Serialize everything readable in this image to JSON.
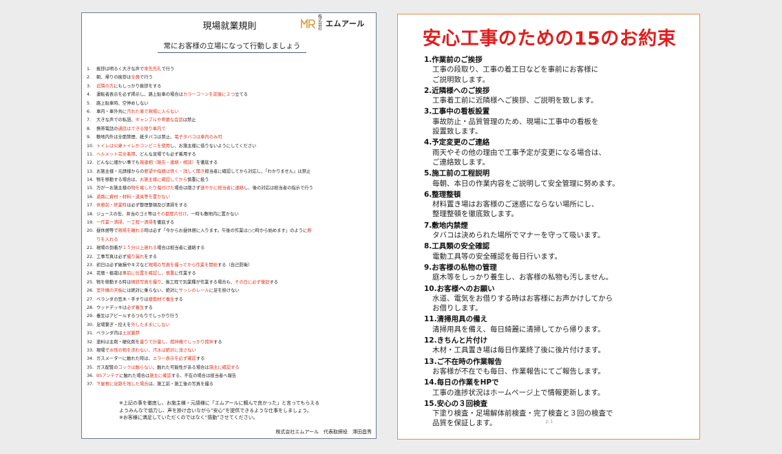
{
  "left": {
    "title": "現場就業規則",
    "logo": {
      "small": "株式会社",
      "name": "エムアール"
    },
    "subtitle": "常にお客様の立場になって行動しましょう",
    "rules": [
      {
        "n": "1.",
        "parts": [
          {
            "t": "挨拶は明るく大きな声で"
          },
          {
            "t": "率先先礼",
            "r": true
          },
          {
            "t": "で行う"
          }
        ]
      },
      {
        "n": "2.",
        "parts": [
          {
            "t": "朝、帰りの挨拶は"
          },
          {
            "t": "全員",
            "r": true
          },
          {
            "t": "で行う"
          }
        ]
      },
      {
        "n": "3.",
        "parts": [
          {
            "t": "近隣の方",
            "r": true
          },
          {
            "t": "にもしっかり挨拶をする"
          }
        ]
      },
      {
        "n": "4.",
        "parts": [
          {
            "t": "運転者表示を必ず掲示し、路上駐車の場合は"
          },
          {
            "t": "カラーコーンを前後に２つ",
            "r": true
          },
          {
            "t": "立てる"
          }
        ]
      },
      {
        "n": "5.",
        "parts": [
          {
            "t": "路上駐車時、空停めしない"
          }
        ]
      },
      {
        "n": "6.",
        "parts": [
          {
            "t": "車内・車外共に"
          },
          {
            "t": "汚れた車で現場に入らない",
            "r": true
          }
        ]
      },
      {
        "n": "7.",
        "parts": [
          {
            "t": "大きな声での私語、"
          },
          {
            "t": "ギャンブルや卑猥な会話",
            "r": true
          },
          {
            "t": "は禁止"
          }
        ]
      },
      {
        "n": "8.",
        "parts": [
          {
            "t": "携帯電話の"
          },
          {
            "t": "通話はできる限り車内で",
            "r": true
          }
        ]
      },
      {
        "n": "9.",
        "parts": [
          {
            "t": "敷地内外は"
          },
          {
            "t": "全面禁煙",
            "r": false
          },
          {
            "t": "、紙タバコは禁止、"
          },
          {
            "t": "電子タバコは車内のみ可",
            "r": true
          }
        ]
      },
      {
        "n": "10.",
        "parts": [
          {
            "t": "トイレは公衆トイレかコンビニを使用",
            "r": true
          },
          {
            "t": "し、お施主様に借りないようにしてください"
          }
        ]
      },
      {
        "n": "11.",
        "parts": [
          {
            "t": "ヘルメット完全着用",
            "r": true
          },
          {
            "t": "、どんな足場でも必ず着用する"
          }
        ]
      },
      {
        "n": "12.",
        "parts": [
          {
            "t": "どんなに細かい事でも"
          },
          {
            "t": "報連相（報告・連絡・相談）",
            "r": true
          },
          {
            "t": "を徹底する"
          }
        ]
      },
      {
        "n": "13.",
        "parts": [
          {
            "t": "お施主様・元請様からの"
          },
          {
            "t": "要望や指摘は快く・詳しく聞き",
            "r": true
          },
          {
            "t": "担当者に確認してから対応し、「わかりません」は禁止"
          }
        ]
      },
      {
        "n": "14.",
        "parts": [
          {
            "t": "物を移動する場合は、"
          },
          {
            "t": "お施主様に確認してから",
            "r": true
          },
          {
            "t": "慎重に扱う"
          }
        ]
      },
      {
        "n": "15.",
        "parts": [
          {
            "t": "万が一お施主様の"
          },
          {
            "t": "物を壊したり傷付けた",
            "r": true
          },
          {
            "t": "場合は隠さず"
          },
          {
            "t": "速やかに担当者に連絡",
            "r": true
          },
          {
            "t": "し、後の対応は担当者の指示で行う"
          }
        ]
      },
      {
        "n": "16.",
        "parts": [
          {
            "t": "道路に資材・材料・道具等を置かない",
            "r": true
          }
        ]
      },
      {
        "n": "17.",
        "parts": [
          {
            "t": "休憩前・終業時",
            "r": true
          },
          {
            "t": "は必ず整理整頓及び清掃をする"
          }
        ]
      },
      {
        "n": "18.",
        "parts": [
          {
            "t": "ジュースの缶、弁当のゴミ等は"
          },
          {
            "t": "その都度片付け",
            "r": true
          },
          {
            "t": "、一時も敷地内に置かない"
          }
        ]
      },
      {
        "n": "19.",
        "parts": [
          {
            "t": "一作業一清掃、一工程一清掃",
            "r": true
          },
          {
            "t": "を徹底する"
          }
        ]
      },
      {
        "n": "20.",
        "wrap": true,
        "parts": [
          {
            "t": "昼休憩等で"
          },
          {
            "t": "現場を離れる",
            "r": true
          },
          {
            "t": "時は必ず「今からお昼休憩に入ります。午後の作業は○○時から始めます」のように"
          },
          {
            "t": "断",
            "r": true
          }
        ],
        "cont": [
          {
            "t": "りを入れる",
            "r": true
          }
        ]
      },
      {
        "n": "21.",
        "parts": [
          {
            "t": "現場の到着が"
          },
          {
            "t": "１５分以上遅れる",
            "r": true
          },
          {
            "t": "場合は担当者に連絡する"
          }
        ]
      },
      {
        "n": "22.",
        "parts": [
          {
            "t": "工事写真は必ず"
          },
          {
            "t": "撮り漏れ",
            "r": true
          },
          {
            "t": "をする"
          }
        ]
      },
      {
        "n": "23.",
        "parts": [
          {
            "t": "初日は必ず破損やキズなど"
          },
          {
            "t": "現場の写真を撮ってから作業を開始",
            "r": true
          },
          {
            "t": "する（自己防衛）"
          }
        ]
      },
      {
        "n": "24.",
        "parts": [
          {
            "t": "花壇・植栽は"
          },
          {
            "t": "事前に位置を確認し、慎重",
            "r": true
          },
          {
            "t": "に作業する"
          }
        ]
      },
      {
        "n": "25.",
        "parts": [
          {
            "t": "物を移動する時は"
          },
          {
            "t": "現状写真を撮り",
            "r": true
          },
          {
            "t": "、後工程で別業種が作業する場合も、"
          },
          {
            "t": "その日に必ず復旧",
            "r": true
          },
          {
            "t": "する"
          }
        ]
      },
      {
        "n": "26.",
        "parts": [
          {
            "t": "室外機の天板",
            "r": true
          },
          {
            "t": "には絶対に乗らない、絶対に"
          },
          {
            "t": "サッシのレール",
            "r": true
          },
          {
            "t": "に足を掛けない"
          }
        ]
      },
      {
        "n": "27.",
        "parts": [
          {
            "t": "ベランダの笠木・手すりは"
          },
          {
            "t": "緩衝材で養生",
            "r": true
          },
          {
            "t": "する"
          }
        ]
      },
      {
        "n": "28.",
        "parts": [
          {
            "t": "ウッドデッキは"
          },
          {
            "t": "必ず養生",
            "r": true
          },
          {
            "t": "する"
          }
        ]
      },
      {
        "n": "29.",
        "parts": [
          {
            "t": "養生はアピールするつもりでしっかり行う"
          }
        ]
      },
      {
        "n": "30.",
        "parts": [
          {
            "t": "足場繋ぎ・控えを"
          },
          {
            "t": "外したままにしない",
            "r": true
          }
        ]
      },
      {
        "n": "31.",
        "parts": [
          {
            "t": "ベランダ内は"
          },
          {
            "t": "土足厳禁",
            "r": true
          }
        ]
      },
      {
        "n": "32.",
        "parts": [
          {
            "t": "塗料は主剤・硬化剤を"
          },
          {
            "t": "量りで計量し、撹拌機でしっかり撹拌",
            "r": true
          },
          {
            "t": "する"
          }
        ]
      },
      {
        "n": "33.",
        "parts": [
          {
            "t": "現場で"
          },
          {
            "t": "水性の物を洗わない、汚水は絶対に流さない",
            "r": true
          }
        ]
      },
      {
        "n": "34.",
        "parts": [
          {
            "t": "ガスメーターに触れた時は、"
          },
          {
            "t": "エラー表示を必ず確認",
            "r": true
          },
          {
            "t": "する"
          }
        ]
      },
      {
        "n": "35.",
        "parts": [
          {
            "t": "ガス配管の"
          },
          {
            "t": "コックは触らない",
            "r": true
          },
          {
            "t": "、触れた可能性がある場合は"
          },
          {
            "t": "施主に確認する",
            "r": true
          }
        ]
      },
      {
        "n": "36.",
        "parts": [
          {
            "t": "BSアンテナ",
            "r": true
          },
          {
            "t": "に触れた場合は"
          },
          {
            "t": "施主に確認",
            "r": true
          },
          {
            "t": "する、不在の場合は担当者へ報告"
          }
        ]
      },
      {
        "n": "37.",
        "parts": [
          {
            "t": "下屋根に足跡を残した場合",
            "r": true
          },
          {
            "t": "は、施工前・施工後の写真を撮る"
          }
        ]
      }
    ],
    "note_lines": [
      "※上記の事を徹底し、お施主様・元請様に「エムアールに頼んで良かった」と言ってもらえる",
      "ようみんなで協力し、声を掛け合いながら“安心”を提供できるような仕事をしましょう。",
      "※お客様に満足していただくのではなく“感動”させてください。"
    ],
    "signature": "株式会社エムアール　代表取締役　澤田昌秀"
  },
  "right": {
    "title": "安心工事のための15のお約束",
    "items": [
      {
        "head": "1.作業前のご挨拶",
        "body": [
          "工事の段取り、工事の着工日などを事前にお客様に",
          "ご説明致します。"
        ]
      },
      {
        "head": "2.近隣様へのご挨拶",
        "body": [
          "工事着工前に近隣様へご挨拶、ご説明を致します。"
        ]
      },
      {
        "head": "3.工事中の看板設置",
        "body": [
          "事故防止・品質管理のため、現場に工事中の看板を",
          "設置致します。"
        ]
      },
      {
        "head": "4.予定変更のご連絡",
        "body": [
          "雨天やその他の理由で工事予定が変更になる場合は、",
          "ご連絡致します。"
        ]
      },
      {
        "head": "5.施工前の工程説明",
        "body": [
          "毎朝、本日の作業内容をご説明して安全管理に努めます。"
        ]
      },
      {
        "head": "6.整理整頓",
        "body": [
          "材料置き場はお客様のご迷惑にならない場所にし、",
          "整理整頓を徹底致します。"
        ]
      },
      {
        "head": "7.敷地内禁煙",
        "body": [
          "タバコは決められた場所でマナーを守って吸います。"
        ]
      },
      {
        "head": "8.工具類の安全確認",
        "body": [
          "電動工具等の安全確認を毎日行います。"
        ]
      },
      {
        "head": "9.お客様の私物の管理",
        "body": [
          "庭木等をしっかり養生し、お客様の私物も汚しません。"
        ]
      },
      {
        "head": "10.お客様へのお願い",
        "body": [
          "水道、電気をお借りする時はお客様にお声かけしてから",
          "お借りします。"
        ]
      },
      {
        "head": "11.清掃用具の備え",
        "body": [
          "清掃用具を備え、毎日綺麗に清掃してから帰ります。"
        ]
      },
      {
        "head": "12.きちんと片付け",
        "body": [
          "木材・工具置き場は毎日作業終了後に後片付けます。"
        ]
      },
      {
        "head": "13.ご不在時の作業報告",
        "body": [
          "お客様が不在でも毎日、作業報告にてご報告します。"
        ]
      },
      {
        "head": "14.毎日の作業をHPで",
        "body": [
          "工事の進捗状況はホームページ上で情報更新します。"
        ]
      },
      {
        "head": "15.安心の３回検査",
        "body": [
          "下塗り検査・足場解体前検査・完了検査と３回の検査で",
          "品質を保証します。"
        ]
      }
    ],
    "page_label": "p.1"
  },
  "colors": {
    "accent_red": "#e0321e",
    "title_red": "#e01e1e",
    "left_border": "#6a7a94",
    "right_border": "#e88a4a"
  }
}
